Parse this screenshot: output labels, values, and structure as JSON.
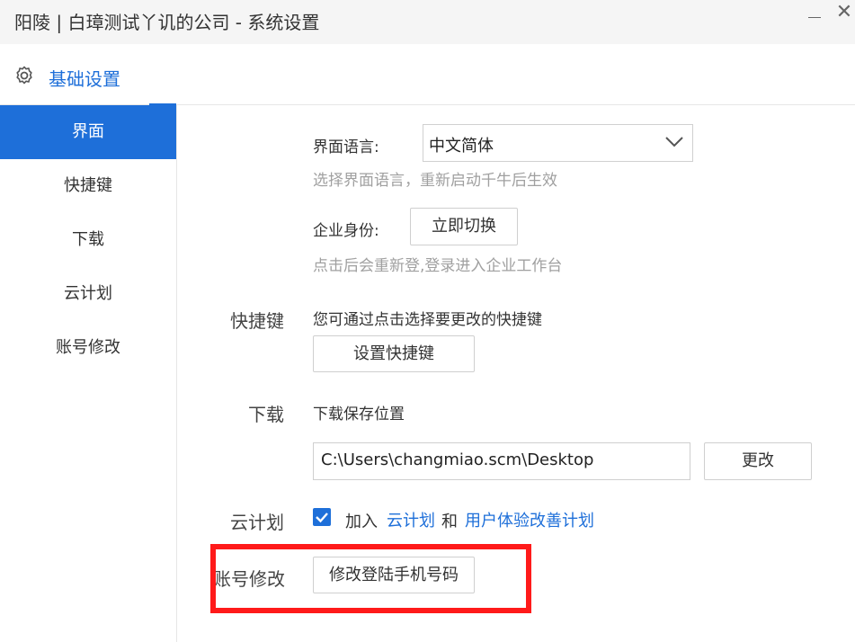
{
  "window": {
    "title": "阳陵 | 白璋测试丫讥的公司 - 系统设置",
    "minimize_icon": "minimize-icon",
    "close_icon": "close-icon",
    "close_glyph": "✕"
  },
  "header": {
    "icon": "gear-icon",
    "title": "基础设置"
  },
  "sidebar": {
    "items": [
      {
        "label": "界面",
        "active": true
      },
      {
        "label": "快捷键",
        "active": false
      },
      {
        "label": "下载",
        "active": false
      },
      {
        "label": "云计划",
        "active": false
      },
      {
        "label": "账号修改",
        "active": false
      }
    ]
  },
  "interface": {
    "language_label": "界面语言:",
    "language_value": "中文简体",
    "language_hint": "选择界面语言，重新启动千牛后生效",
    "identity_label": "企业身份:",
    "switch_button": "立即切换",
    "identity_hint": "点击后会重新登,登录进入企业工作台"
  },
  "shortcuts": {
    "section_label": "快捷键",
    "description": "您可通过点击选择要更改的快捷键",
    "button": "设置快捷键"
  },
  "download": {
    "section_label": "下载",
    "description": "下载保存位置",
    "path": "C:\\Users\\changmiao.scm\\Desktop",
    "change_button": "更改"
  },
  "cloud_plan": {
    "section_label": "云计划",
    "checked": true,
    "join_text": "加入",
    "link1": "云计划",
    "and_text": "和",
    "link2": "用户体验改善计划"
  },
  "account": {
    "section_label": "账号修改",
    "button": "修改登陆手机号码"
  },
  "colors": {
    "accent": "#1e6fd9",
    "highlight_box": "#ff1a1a"
  }
}
